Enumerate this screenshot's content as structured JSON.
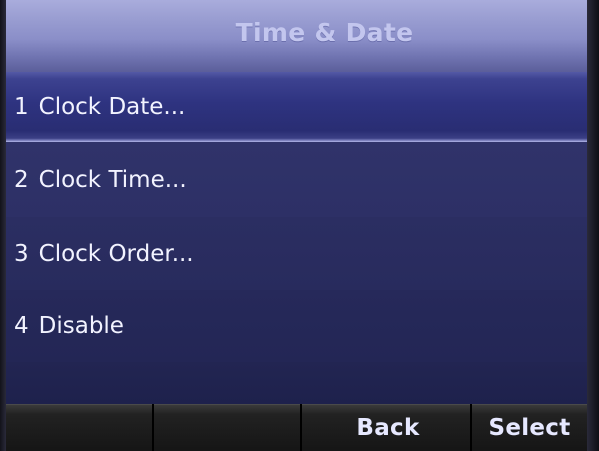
{
  "header": {
    "title": "Time & Date"
  },
  "menu": {
    "items": [
      {
        "number": "1",
        "label": "Clock Date..."
      },
      {
        "number": "2",
        "label": "Clock Time..."
      },
      {
        "number": "3",
        "label": "Clock Order..."
      },
      {
        "number": "4",
        "label": "Disable"
      }
    ],
    "selected_index": 0
  },
  "softkeys": {
    "key1": "",
    "key2": "",
    "key3": "Back",
    "key4": "Select"
  },
  "colors": {
    "title_bar": "#8a8ec8",
    "menu_background": "#2d3063",
    "selection_highlight": "#2e3380",
    "softkey_bar": "#1a1a1a",
    "text": "#f2f3ff"
  }
}
